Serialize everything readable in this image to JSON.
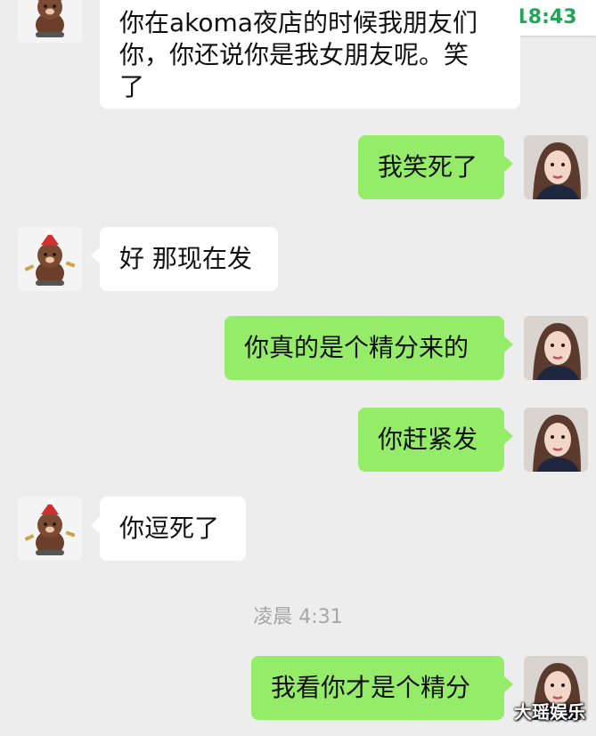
{
  "clock": {
    "time": "18:43"
  },
  "messages": [
    {
      "sender": "bear",
      "text": "你在akoma夜店的时候我朋友们\n你，你还说你是我女朋友呢。笑\n了"
    },
    {
      "sender": "me",
      "text": "我笑死了"
    },
    {
      "sender": "bear",
      "text": "好 那现在发"
    },
    {
      "sender": "me",
      "text": "你真的是个精分来的"
    },
    {
      "sender": "me",
      "text": "你赶紧发"
    },
    {
      "sender": "bear",
      "text": "你逗死了"
    },
    {
      "sender": "me",
      "text": "我看你才是个精分"
    }
  ],
  "timestamp": "凌晨 4:31",
  "watermark": "大瑶娱乐",
  "colors": {
    "background": "#ededed",
    "outgoing_bubble": "#95ec69",
    "incoming_bubble": "#ffffff",
    "clock_text": "#22a559"
  },
  "icons": {
    "bear_avatar": "brown-bear-avatar-icon",
    "girl_avatar": "girl-portrait-avatar-icon"
  }
}
